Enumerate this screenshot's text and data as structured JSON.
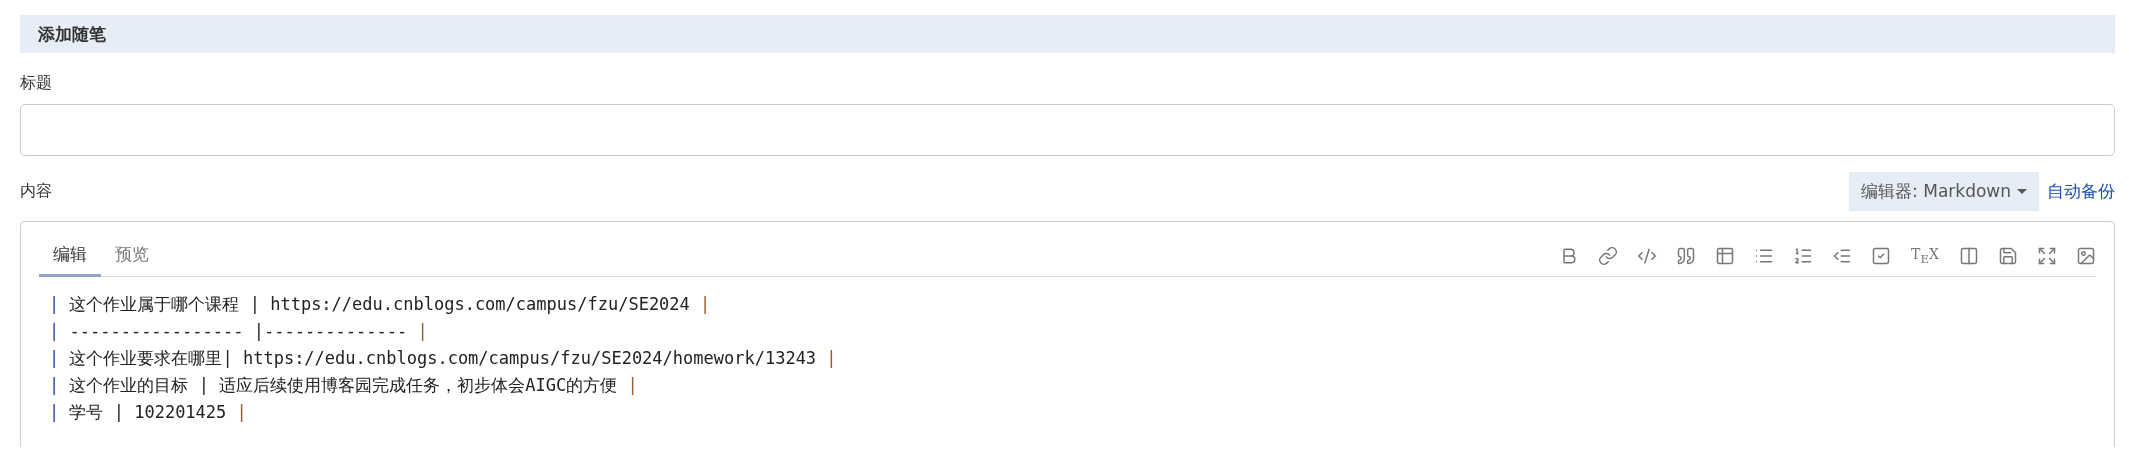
{
  "section_title": "添加随笔",
  "title_field": {
    "label": "标题"
  },
  "content": {
    "label": "内容",
    "editor_select": "编辑器: Markdown",
    "autosave_link": "自动备份"
  },
  "editor": {
    "tabs": [
      {
        "label": "编辑",
        "selected": true
      },
      {
        "label": "预览",
        "selected": false
      }
    ],
    "toolbar": [
      {
        "kind": "bold"
      },
      {
        "kind": "link"
      },
      {
        "kind": "code"
      },
      {
        "kind": "quote"
      },
      {
        "kind": "table"
      },
      {
        "kind": "bullet-list"
      },
      {
        "kind": "numbered-list"
      },
      {
        "kind": "indent"
      },
      {
        "kind": "task"
      },
      {
        "kind": "tex",
        "label": "T$_{E}$X"
      },
      {
        "kind": "columns"
      },
      {
        "kind": "save"
      },
      {
        "kind": "fullscreen"
      },
      {
        "kind": "image"
      }
    ],
    "lines": [
      [
        {
          "kind": "lead",
          "text": "|"
        },
        {
          "kind": "body",
          "text": " 这个作业属于哪个课程 | https://edu.cnblogs.com/campus/fzu/SE2024 "
        },
        {
          "kind": "tail",
          "text": "|"
        }
      ],
      [
        {
          "kind": "lead",
          "text": "|"
        },
        {
          "kind": "body",
          "text": " ----------------- |-------------- "
        },
        {
          "kind": "tail",
          "text": "|"
        }
      ],
      [
        {
          "kind": "lead",
          "text": "|"
        },
        {
          "kind": "body",
          "text": " 这个作业要求在哪里| https://edu.cnblogs.com/campus/fzu/SE2024/homework/13243 "
        },
        {
          "kind": "tail",
          "text": "|"
        }
      ],
      [
        {
          "kind": "lead",
          "text": "|"
        },
        {
          "kind": "body",
          "text": " 这个作业的目标 | 适应后续使用博客园完成任务，初步体会AIGC的方便 "
        },
        {
          "kind": "tail",
          "text": "|"
        }
      ],
      [
        {
          "kind": "lead",
          "text": "|"
        },
        {
          "kind": "body",
          "text": " 学号 | 102201425 "
        },
        {
          "kind": "tail",
          "text": "|"
        }
      ]
    ]
  }
}
